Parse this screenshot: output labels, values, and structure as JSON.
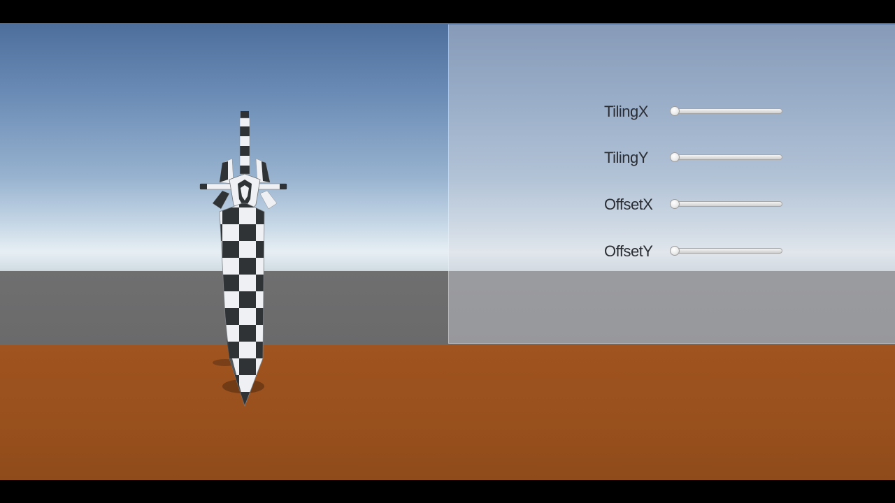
{
  "scene": {
    "colors": {
      "sky_top": "#4d6e9b",
      "horizon": "#e7eff4",
      "ground": "#6f6f70",
      "floor": "#a0541f"
    },
    "object": "checkered-sword"
  },
  "panel": {
    "sliders": [
      {
        "label": "TilingX",
        "value": 0
      },
      {
        "label": "TilingY",
        "value": 0
      },
      {
        "label": "OffsetX",
        "value": 0
      },
      {
        "label": "OffsetY",
        "value": 0
      }
    ]
  }
}
